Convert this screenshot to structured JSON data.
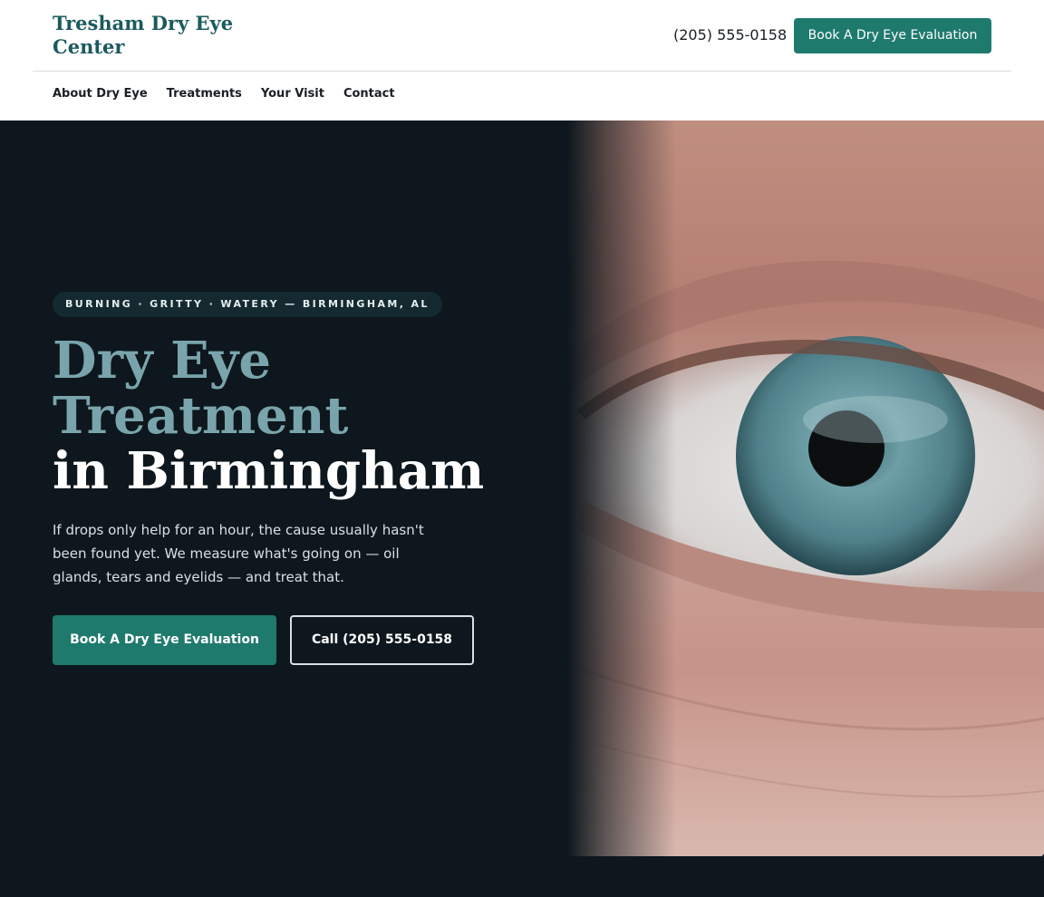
{
  "header": {
    "brand": "Tresham Dry Eye Center",
    "phone": "(205) 555-0158",
    "cta_label": "Book A Dry Eye Evaluation"
  },
  "nav": {
    "items": [
      {
        "label": "About Dry Eye"
      },
      {
        "label": "Treatments"
      },
      {
        "label": "Your Visit"
      },
      {
        "label": "Contact"
      }
    ]
  },
  "hero": {
    "tagline": "BURNING · GRITTY · WATERY — BIRMINGHAM, AL",
    "title_line1": "Dry Eye",
    "title_line2": "Treatment",
    "title_line3": "in Birmingham",
    "lede": "If drops only help for an hour, the cause usually hasn't been found yet. We measure what's going on — oil glands, tears and eyelids — and treat that.",
    "primary_cta": "Book A Dry Eye Evaluation",
    "secondary_cta": "Call (205) 555-0158",
    "image_subject": "close-up photo of a blue eye"
  },
  "colors": {
    "brand": "#1b5a5e",
    "accent": "#1f7a6e",
    "hero_bg": "#0d171d",
    "title_muted": "#7aa4ab"
  }
}
